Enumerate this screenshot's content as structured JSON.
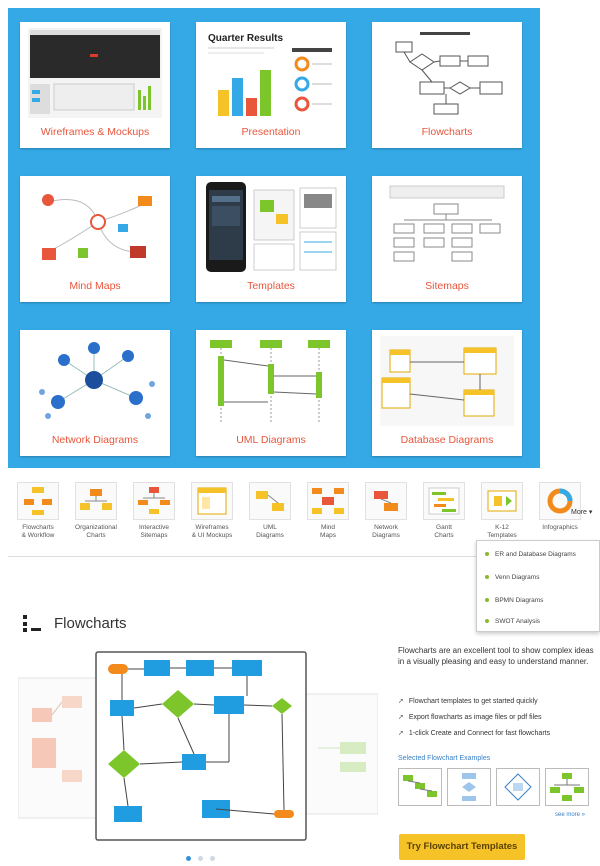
{
  "gallery": {
    "tiles": [
      {
        "label": "Wireframes & Mockups"
      },
      {
        "label": "Presentation",
        "thumb_title": "Quarter Results"
      },
      {
        "label": "Flowcharts"
      },
      {
        "label": "Mind Maps"
      },
      {
        "label": "Templates"
      },
      {
        "label": "Sitemaps"
      },
      {
        "label": "Network Diagrams"
      },
      {
        "label": "UML Diagrams"
      },
      {
        "label": "Database Diagrams"
      }
    ]
  },
  "categories": [
    {
      "label": "Flowcharts\n& Workflow",
      "icon": "flowchart-icon"
    },
    {
      "label": "Organizational\nCharts",
      "icon": "org-chart-icon"
    },
    {
      "label": "Interactive\nSitemaps",
      "icon": "sitemap-icon"
    },
    {
      "label": "Wireframes\n& UI Mockups",
      "icon": "wireframe-icon"
    },
    {
      "label": "UML\nDiagrams",
      "icon": "uml-icon"
    },
    {
      "label": "Mind\nMaps",
      "icon": "mindmap-icon"
    },
    {
      "label": "Network\nDiagrams",
      "icon": "network-icon"
    },
    {
      "label": "Gantt\nCharts",
      "icon": "gantt-icon"
    },
    {
      "label": "K-12\nTemplates",
      "icon": "k12-icon"
    },
    {
      "label": "Infographics",
      "icon": "infographic-icon"
    }
  ],
  "more_label": "More ▾",
  "more_menu": [
    "ER and Database Diagrams",
    "Venn Diagrams",
    "BPMN Diagrams",
    "SWOT Analysis"
  ],
  "section": {
    "title": "Flowcharts",
    "description": "Flowcharts are an excellent tool to show complex ideas in a visually pleasing and easy to understand manner.",
    "bullets": [
      "Flowchart templates to get started quickly",
      "Export flowcharts as image files or pdf files",
      "1-click Create and Connect for fast flowcharts"
    ],
    "examples_label": "Selected Flowchart Examples",
    "see_more": "see more »",
    "cta": "Try Flowchart Templates"
  },
  "colors": {
    "accent_blue": "#35a9e6",
    "label_red": "#e8563c",
    "cta_yellow": "#f5c228",
    "flow_blue": "#1f9de0",
    "flow_green": "#7cc62b",
    "flow_orange": "#f28a1c"
  }
}
